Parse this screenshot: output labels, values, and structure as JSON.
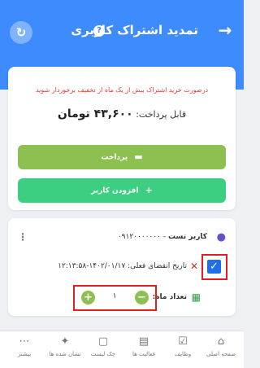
{
  "header": {
    "title": "تمدید اشتراک کاربری",
    "help_icon": "question-circle-icon",
    "back_icon": "arrow-right-icon",
    "refresh_icon": "refresh-icon",
    "color": "#3d8bfd"
  },
  "payment": {
    "note": "درصورت خرید اشتراک بیش از یک ماه از تخفیف برخوردار شوید",
    "payable_label": "قابل پرداخت:",
    "amount": "۴۳,۶۰۰ تومان",
    "pay_button": "پرداخت",
    "add_user_button": "افزودن کاربر",
    "pay_color": "#8cc152",
    "add_color": "#3ccf82"
  },
  "user": {
    "name": "کاربر تست",
    "phone": "۰۹۱۲۰۰۰۰۰۰۰",
    "expiry_label": "تاریخ انقضای فعلی:",
    "expiry_value": "۱۴۰۲/۰۱/۱۷-۱۲:۱۳:۵۸",
    "count_label": "تعداد ماه:",
    "quantity": "۱",
    "checked": true
  },
  "nav": {
    "items": [
      {
        "label": "صفحه اصلی",
        "icon": "home-icon"
      },
      {
        "label": "وظایف",
        "icon": "tasks-icon"
      },
      {
        "label": "فعالیت ها",
        "icon": "activities-icon"
      },
      {
        "label": "چک لیست",
        "icon": "checklist-icon"
      },
      {
        "label": "نشان شده ها",
        "icon": "pin-icon"
      },
      {
        "label": "بیشتر",
        "icon": "more-icon"
      }
    ]
  }
}
